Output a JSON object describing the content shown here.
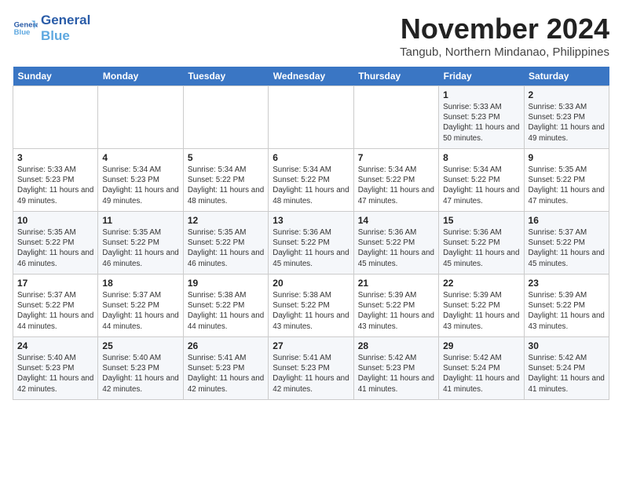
{
  "logo": {
    "line1": "General",
    "line2": "Blue"
  },
  "title": "November 2024",
  "location": "Tangub, Northern Mindanao, Philippines",
  "days_of_week": [
    "Sunday",
    "Monday",
    "Tuesday",
    "Wednesday",
    "Thursday",
    "Friday",
    "Saturday"
  ],
  "weeks": [
    [
      {
        "day": "",
        "text": ""
      },
      {
        "day": "",
        "text": ""
      },
      {
        "day": "",
        "text": ""
      },
      {
        "day": "",
        "text": ""
      },
      {
        "day": "",
        "text": ""
      },
      {
        "day": "1",
        "text": "Sunrise: 5:33 AM\nSunset: 5:23 PM\nDaylight: 11 hours and 50 minutes."
      },
      {
        "day": "2",
        "text": "Sunrise: 5:33 AM\nSunset: 5:23 PM\nDaylight: 11 hours and 49 minutes."
      }
    ],
    [
      {
        "day": "3",
        "text": "Sunrise: 5:33 AM\nSunset: 5:23 PM\nDaylight: 11 hours and 49 minutes."
      },
      {
        "day": "4",
        "text": "Sunrise: 5:34 AM\nSunset: 5:23 PM\nDaylight: 11 hours and 49 minutes."
      },
      {
        "day": "5",
        "text": "Sunrise: 5:34 AM\nSunset: 5:22 PM\nDaylight: 11 hours and 48 minutes."
      },
      {
        "day": "6",
        "text": "Sunrise: 5:34 AM\nSunset: 5:22 PM\nDaylight: 11 hours and 48 minutes."
      },
      {
        "day": "7",
        "text": "Sunrise: 5:34 AM\nSunset: 5:22 PM\nDaylight: 11 hours and 47 minutes."
      },
      {
        "day": "8",
        "text": "Sunrise: 5:34 AM\nSunset: 5:22 PM\nDaylight: 11 hours and 47 minutes."
      },
      {
        "day": "9",
        "text": "Sunrise: 5:35 AM\nSunset: 5:22 PM\nDaylight: 11 hours and 47 minutes."
      }
    ],
    [
      {
        "day": "10",
        "text": "Sunrise: 5:35 AM\nSunset: 5:22 PM\nDaylight: 11 hours and 46 minutes."
      },
      {
        "day": "11",
        "text": "Sunrise: 5:35 AM\nSunset: 5:22 PM\nDaylight: 11 hours and 46 minutes."
      },
      {
        "day": "12",
        "text": "Sunrise: 5:35 AM\nSunset: 5:22 PM\nDaylight: 11 hours and 46 minutes."
      },
      {
        "day": "13",
        "text": "Sunrise: 5:36 AM\nSunset: 5:22 PM\nDaylight: 11 hours and 45 minutes."
      },
      {
        "day": "14",
        "text": "Sunrise: 5:36 AM\nSunset: 5:22 PM\nDaylight: 11 hours and 45 minutes."
      },
      {
        "day": "15",
        "text": "Sunrise: 5:36 AM\nSunset: 5:22 PM\nDaylight: 11 hours and 45 minutes."
      },
      {
        "day": "16",
        "text": "Sunrise: 5:37 AM\nSunset: 5:22 PM\nDaylight: 11 hours and 45 minutes."
      }
    ],
    [
      {
        "day": "17",
        "text": "Sunrise: 5:37 AM\nSunset: 5:22 PM\nDaylight: 11 hours and 44 minutes."
      },
      {
        "day": "18",
        "text": "Sunrise: 5:37 AM\nSunset: 5:22 PM\nDaylight: 11 hours and 44 minutes."
      },
      {
        "day": "19",
        "text": "Sunrise: 5:38 AM\nSunset: 5:22 PM\nDaylight: 11 hours and 44 minutes."
      },
      {
        "day": "20",
        "text": "Sunrise: 5:38 AM\nSunset: 5:22 PM\nDaylight: 11 hours and 43 minutes."
      },
      {
        "day": "21",
        "text": "Sunrise: 5:39 AM\nSunset: 5:22 PM\nDaylight: 11 hours and 43 minutes."
      },
      {
        "day": "22",
        "text": "Sunrise: 5:39 AM\nSunset: 5:22 PM\nDaylight: 11 hours and 43 minutes."
      },
      {
        "day": "23",
        "text": "Sunrise: 5:39 AM\nSunset: 5:22 PM\nDaylight: 11 hours and 43 minutes."
      }
    ],
    [
      {
        "day": "24",
        "text": "Sunrise: 5:40 AM\nSunset: 5:23 PM\nDaylight: 11 hours and 42 minutes."
      },
      {
        "day": "25",
        "text": "Sunrise: 5:40 AM\nSunset: 5:23 PM\nDaylight: 11 hours and 42 minutes."
      },
      {
        "day": "26",
        "text": "Sunrise: 5:41 AM\nSunset: 5:23 PM\nDaylight: 11 hours and 42 minutes."
      },
      {
        "day": "27",
        "text": "Sunrise: 5:41 AM\nSunset: 5:23 PM\nDaylight: 11 hours and 42 minutes."
      },
      {
        "day": "28",
        "text": "Sunrise: 5:42 AM\nSunset: 5:23 PM\nDaylight: 11 hours and 41 minutes."
      },
      {
        "day": "29",
        "text": "Sunrise: 5:42 AM\nSunset: 5:24 PM\nDaylight: 11 hours and 41 minutes."
      },
      {
        "day": "30",
        "text": "Sunrise: 5:42 AM\nSunset: 5:24 PM\nDaylight: 11 hours and 41 minutes."
      }
    ]
  ]
}
